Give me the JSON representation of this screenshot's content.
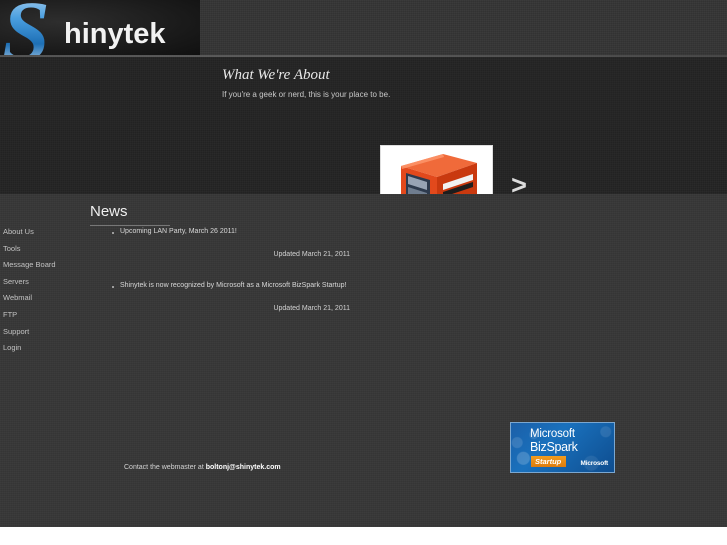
{
  "site": {
    "logo_letter": "S",
    "logo_word": "hinytek"
  },
  "hero": {
    "title": "What We're About",
    "subtitle": "If you're a geek or nerd, this is your place to be.",
    "photo_alt": "orange-computer-case",
    "next_arrow": ">"
  },
  "sidebar": {
    "items": [
      {
        "label": "About Us"
      },
      {
        "label": "Tools"
      },
      {
        "label": "Message Board"
      },
      {
        "label": "Servers"
      },
      {
        "label": "Webmail"
      },
      {
        "label": "FTP"
      },
      {
        "label": "Support"
      },
      {
        "label": "Login"
      }
    ]
  },
  "news": {
    "heading": "News",
    "entries": [
      {
        "text": "Upcoming LAN Party, March 26 2011!",
        "updated": "Updated March 21, 2011"
      },
      {
        "text": "Shinytek is now recognized by Microsoft as a Microsoft BizSpark Startup!",
        "updated": "Updated March 21, 2011"
      }
    ]
  },
  "bizspark": {
    "line1": "Microsoft",
    "line2": "BizSpark",
    "tag": "Startup",
    "corner": "Microsoft"
  },
  "footer": {
    "contact_prefix": "Contact the webmaster at ",
    "email": "boltonj@shinytek.com"
  },
  "colors": {
    "page_dark": "#373737",
    "hero_dark": "#242424",
    "header_dark": "#343434",
    "logo_blue": "#2f8fd8",
    "bizspark_blue": "#1a71bd",
    "startup_orange": "#e8860f",
    "case_orange": "#e8491c"
  }
}
